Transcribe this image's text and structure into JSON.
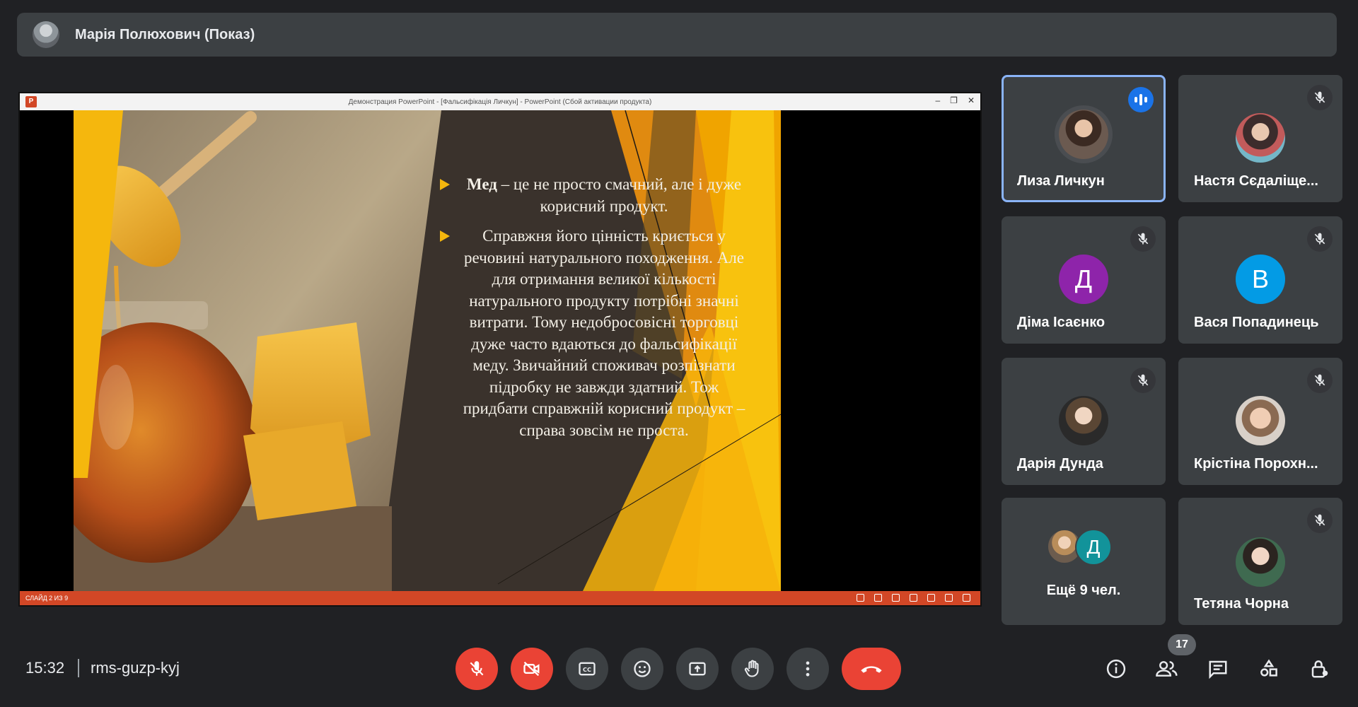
{
  "presenter": {
    "name": "Марія Полюхович (Показ)"
  },
  "powerpoint": {
    "window_title": "Демонстрация PowerPoint - [Фальсифікація Личкун] - PowerPoint (Сбой активации продукта)",
    "slide_counter": "СЛАЙД 2 ИЗ 9",
    "bullet1_bold": "Мед",
    "bullet1_rest": " – це не просто смачний, але і дуже корисний продукт.",
    "bullet2": "Справжня його цінність криється у речовині натурального походження. Але для отримання великої кількості натурального продукту потрібні значні витрати. Тому недобросовісні торговці дуже часто вдаються до фальсифікації меду. Звичайний споживач розпізнати підробку не завжди здатний. Тож придбати справжній корисний продукт – справа зовсім не проста."
  },
  "participants": [
    {
      "name": "Лиза Личкун",
      "state": "speaking"
    },
    {
      "name": "Настя Сєдаліще...",
      "state": "muted"
    },
    {
      "name": "Діма Ісаєнко",
      "initial": "Д",
      "color": "#8e24aa",
      "state": "muted"
    },
    {
      "name": "Вася Попадинець",
      "initial": "В",
      "color": "#039be5",
      "state": "muted"
    },
    {
      "name": "Дарія Дунда",
      "state": "muted"
    },
    {
      "name": "Крістіна Порохн...",
      "state": "muted"
    },
    {
      "name": "Тетяна Чорна",
      "state": "muted"
    }
  ],
  "more_participants": {
    "label": "Ещё 9 чел.",
    "initial": "Д"
  },
  "bottom_bar": {
    "time": "15:32",
    "meeting_code": "rms-guzp-kyj",
    "people_count": "17"
  },
  "colors": {
    "accent": "#8ab4f8",
    "danger": "#ea4335",
    "speaking": "#1a73e8",
    "slide_yellow": "#f5b70d",
    "status_bar": "#d24726"
  }
}
